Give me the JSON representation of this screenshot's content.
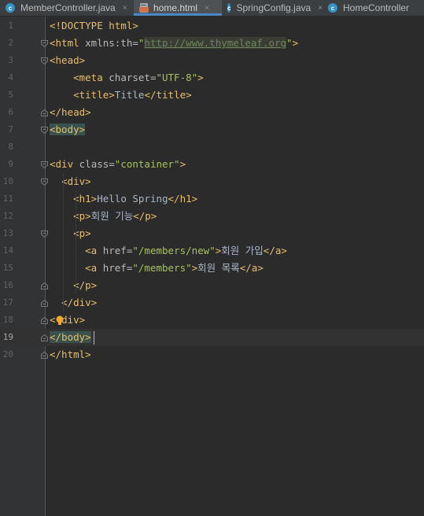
{
  "tabs": [
    {
      "label": "MemberController.java",
      "icon": "class-c-icon",
      "active": false
    },
    {
      "label": "home.html",
      "icon": "html-file-icon",
      "active": true
    },
    {
      "label": "SpringConfig.java",
      "icon": "class-c-icon",
      "active": false
    },
    {
      "label": "HomeController",
      "icon": "class-c-icon",
      "active": false
    }
  ],
  "close_glyph": "×",
  "lines": [
    {
      "num": "1",
      "segments": [
        {
          "c": "t",
          "v": "<!DOCTYPE html>"
        }
      ]
    },
    {
      "num": "2",
      "segments": [
        {
          "c": "t",
          "v": "<html "
        },
        {
          "c": "a",
          "v": "xmlns:th="
        },
        {
          "c": "s",
          "v": "\""
        },
        {
          "c": "url",
          "v": "http://www.thymeleaf.org"
        },
        {
          "c": "s",
          "v": "\""
        },
        {
          "c": "t",
          "v": ">"
        }
      ]
    },
    {
      "num": "3",
      "segments": [
        {
          "c": "t",
          "v": "<head>"
        }
      ]
    },
    {
      "num": "4",
      "segments": [
        {
          "c": "p",
          "v": "    "
        },
        {
          "c": "t",
          "v": "<meta "
        },
        {
          "c": "a",
          "v": "charset="
        },
        {
          "c": "s",
          "v": "\"UTF-8\""
        },
        {
          "c": "t",
          "v": ">"
        }
      ]
    },
    {
      "num": "5",
      "segments": [
        {
          "c": "p",
          "v": "    "
        },
        {
          "c": "t",
          "v": "<title>"
        },
        {
          "c": "p",
          "v": "Title"
        },
        {
          "c": "t",
          "v": "</title>"
        }
      ]
    },
    {
      "num": "6",
      "segments": [
        {
          "c": "t",
          "v": "</head>"
        }
      ]
    },
    {
      "num": "7",
      "segments": [
        {
          "c": "hl",
          "v": "<body>"
        }
      ]
    },
    {
      "num": "8",
      "segments": []
    },
    {
      "num": "9",
      "segments": [
        {
          "c": "t",
          "v": "<div "
        },
        {
          "c": "a",
          "v": "class="
        },
        {
          "c": "s",
          "v": "\"container\""
        },
        {
          "c": "t",
          "v": ">"
        }
      ]
    },
    {
      "num": "10",
      "segments": [
        {
          "c": "p",
          "v": "  "
        },
        {
          "c": "t",
          "v": "<div>"
        }
      ]
    },
    {
      "num": "11",
      "segments": [
        {
          "c": "p",
          "v": "    "
        },
        {
          "c": "t",
          "v": "<h1>"
        },
        {
          "c": "p",
          "v": "Hello Spring"
        },
        {
          "c": "t",
          "v": "</h1>"
        }
      ]
    },
    {
      "num": "12",
      "segments": [
        {
          "c": "p",
          "v": "    "
        },
        {
          "c": "t",
          "v": "<p>"
        },
        {
          "c": "p",
          "v": "회원 기능"
        },
        {
          "c": "t",
          "v": "</p>"
        }
      ]
    },
    {
      "num": "13",
      "segments": [
        {
          "c": "p",
          "v": "    "
        },
        {
          "c": "t",
          "v": "<p>"
        }
      ]
    },
    {
      "num": "14",
      "segments": [
        {
          "c": "p",
          "v": "      "
        },
        {
          "c": "t",
          "v": "<a "
        },
        {
          "c": "a",
          "v": "href="
        },
        {
          "c": "s",
          "v": "\"/members/new\""
        },
        {
          "c": "t",
          "v": ">"
        },
        {
          "c": "p",
          "v": "회원 가입"
        },
        {
          "c": "t",
          "v": "</a>"
        }
      ]
    },
    {
      "num": "15",
      "segments": [
        {
          "c": "p",
          "v": "      "
        },
        {
          "c": "t",
          "v": "<a "
        },
        {
          "c": "a",
          "v": "href="
        },
        {
          "c": "s",
          "v": "\"/members\""
        },
        {
          "c": "t",
          "v": ">"
        },
        {
          "c": "p",
          "v": "회원 목록"
        },
        {
          "c": "t",
          "v": "</a>"
        }
      ]
    },
    {
      "num": "16",
      "segments": [
        {
          "c": "p",
          "v": "    "
        },
        {
          "c": "t",
          "v": "</p>"
        }
      ]
    },
    {
      "num": "17",
      "segments": [
        {
          "c": "p",
          "v": "  "
        },
        {
          "c": "t",
          "v": "</div>"
        }
      ]
    },
    {
      "num": "18",
      "segments": [
        {
          "c": "t",
          "v": "<"
        },
        {
          "c": "bulbspace",
          "v": " "
        },
        {
          "c": "t",
          "v": "div>"
        }
      ]
    },
    {
      "num": "19",
      "segments": [
        {
          "c": "hl",
          "v": "</body>"
        }
      ],
      "current": true
    },
    {
      "num": "20",
      "segments": [
        {
          "c": "t",
          "v": "</html>"
        }
      ]
    }
  ],
  "colors": {
    "tag": "#e8bf6a",
    "attr": "#bababa",
    "string": "#a5c25c",
    "text": "#a9b7c6",
    "accent": "#4a88c7"
  }
}
